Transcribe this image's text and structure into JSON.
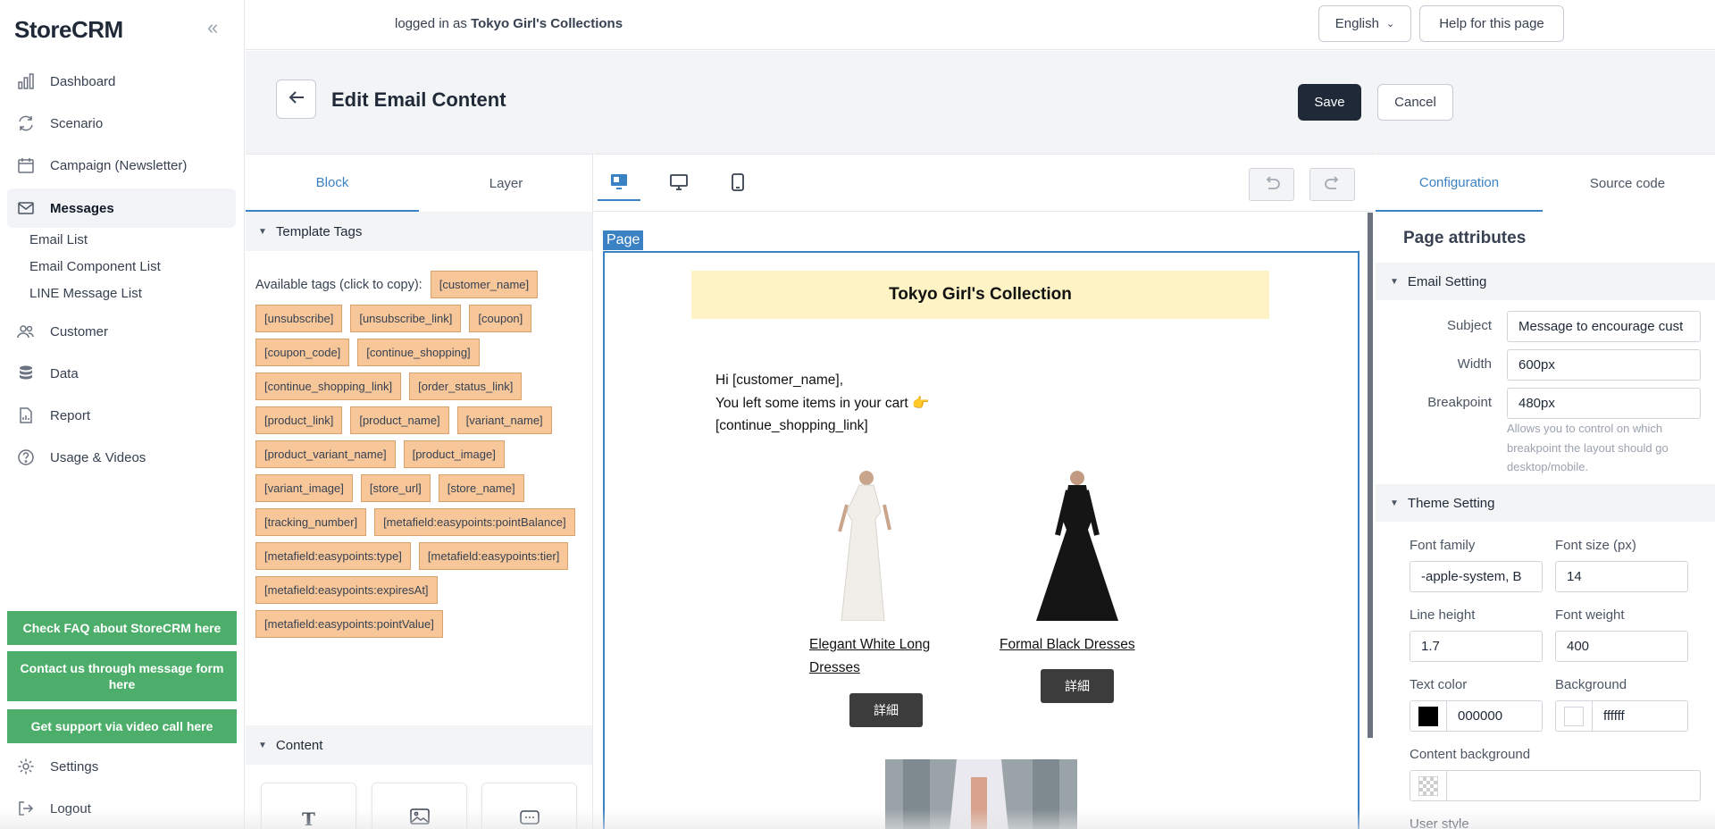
{
  "app": {
    "name": "StoreCRM"
  },
  "sidebar": {
    "items": [
      {
        "label": "Dashboard",
        "icon": "chart-bar-icon"
      },
      {
        "label": "Scenario",
        "icon": "refresh-icon"
      },
      {
        "label": "Campaign (Newsletter)",
        "icon": "calendar-icon"
      },
      {
        "label": "Messages",
        "icon": "envelope-icon"
      },
      {
        "label": "Customer",
        "icon": "users-icon"
      },
      {
        "label": "Data",
        "icon": "database-icon"
      },
      {
        "label": "Report",
        "icon": "document-chart-icon"
      },
      {
        "label": "Usage & Videos",
        "icon": "question-circle-icon"
      }
    ],
    "sub_items": [
      "Email List",
      "Email Component List",
      "LINE Message List"
    ],
    "support_buttons": [
      "Check FAQ about StoreCRM here",
      "Contact us through message form here",
      "Get support via video call here"
    ],
    "settings_label": "Settings",
    "logout_label": "Logout"
  },
  "topbar": {
    "logged_prefix": "logged in as",
    "store_name": "Tokyo Girl's Collections",
    "language": "English",
    "help": "Help for this page"
  },
  "header": {
    "title": "Edit Email Content",
    "save": "Save",
    "cancel": "Cancel"
  },
  "left_panel": {
    "tabs": [
      "Block",
      "Layer"
    ],
    "template_tags_title": "Template Tags",
    "available_label": "Available tags (click to copy):",
    "tags": [
      "[customer_name]",
      "[unsubscribe]",
      "[unsubscribe_link]",
      "[coupon]",
      "[coupon_code]",
      "[continue_shopping]",
      "[continue_shopping_link]",
      "[order_status_link]",
      "[product_link]",
      "[product_name]",
      "[variant_name]",
      "[product_variant_name]",
      "[product_image]",
      "[variant_image]",
      "[store_url]",
      "[store_name]",
      "[tracking_number]",
      "[metafield:easypoints:pointBalance]",
      "[metafield:easypoints:type]",
      "[metafield:easypoints:tier]",
      "[metafield:easypoints:expiresAt]",
      "[metafield:easypoints:pointValue]"
    ],
    "content_title": "Content",
    "content_blocks": [
      "text-block-icon",
      "image-block-icon",
      "button-block-icon"
    ]
  },
  "canvas": {
    "page_label": "Page",
    "email": {
      "banner": "Tokyo Girl's Collection",
      "line1": "Hi [customer_name],",
      "line2": "You left some items in your cart 👉",
      "line3": "[continue_shopping_link]",
      "products": [
        {
          "name_line1": "Elegant White Long",
          "name_line2": "Dresses",
          "button": "詳細",
          "color": "#e8e6e0"
        },
        {
          "name_line1": "Formal Black Dresses",
          "name_line2": "",
          "button": "詳細",
          "color": "#1a1a1a"
        }
      ]
    }
  },
  "right_panel": {
    "tabs": [
      "Configuration",
      "Source code"
    ],
    "title": "Page attributes",
    "email_setting": {
      "title": "Email Setting",
      "subject_label": "Subject",
      "subject_value": "Message to encourage cust",
      "width_label": "Width",
      "width_value": "600px",
      "breakpoint_label": "Breakpoint",
      "breakpoint_value": "480px",
      "breakpoint_help": "Allows you to control on which breakpoint the layout should go desktop/mobile."
    },
    "theme_setting": {
      "title": "Theme Setting",
      "font_family_label": "Font family",
      "font_family_value": "-apple-system, B",
      "font_size_label": "Font size (px)",
      "font_size_value": "14",
      "line_height_label": "Line height",
      "line_height_value": "1.7",
      "font_weight_label": "Font weight",
      "font_weight_value": "400",
      "text_color_label": "Text color",
      "text_color_value": "000000",
      "background_label": "Background",
      "background_value": "ffffff",
      "content_bg_label": "Content background",
      "user_style_label": "User style"
    }
  },
  "colors": {
    "accent": "#3b82c4",
    "primary_button": "#1f2937",
    "support_green": "#4cae6a",
    "tag_bg": "#f7c79a",
    "banner_bg": "#fdf3c4"
  }
}
